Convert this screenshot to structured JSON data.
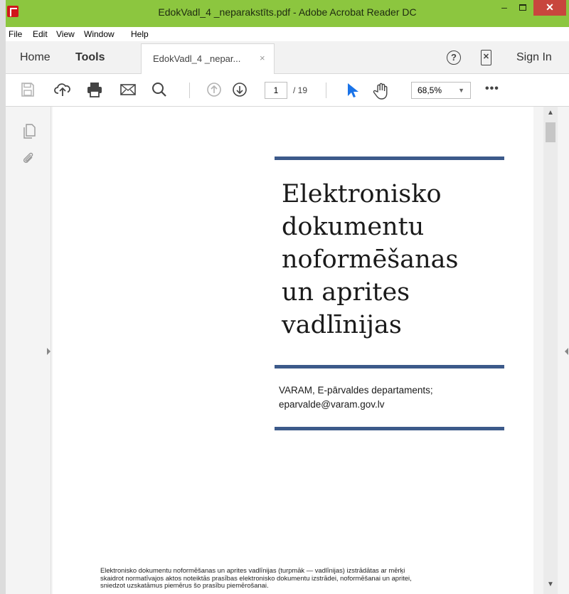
{
  "window": {
    "title": "EdokVadl_4 _neparakstīts.pdf - Adobe Acrobat Reader DC",
    "min_glyph": "–",
    "close_glyph": "✕"
  },
  "menu": {
    "items": [
      "File",
      "Edit",
      "View",
      "Window",
      "Help"
    ]
  },
  "tabs": {
    "home": "Home",
    "tools": "Tools",
    "document": "EdokVadl_4 _nepar...",
    "close_glyph": "×"
  },
  "header_right": {
    "help_glyph": "?",
    "sign_in": "Sign In"
  },
  "toolbar": {
    "page_current": "1",
    "page_total": "/ 19",
    "zoom": "68,5%",
    "zoom_chevron": "▼",
    "more": "•••"
  },
  "pdf": {
    "title_lines": [
      "Elektronisko",
      "dokumentu",
      "noformēšanas",
      "un aprites",
      "vadlīnijas"
    ],
    "author_lines": [
      "VARAM, E-pārvaldes departaments;",
      "eparvalde@varam.gov.lv"
    ],
    "intro_lines": [
      "Elektronisko dokumentu noformēšanas un aprites vadlīnijas (turpmāk — vadlīnijas) izstrādātas ar mērķi",
      "skaidrot normatīvajos aktos noteiktās prasības elektronisko dokumentu izstrādei, noformēšanai un apritei,",
      "sniedzot uzskatāmus piemērus šo prasību piemērošanai."
    ]
  },
  "scrollbar": {
    "up_glyph": "▲",
    "down_glyph": "▼"
  },
  "colors": {
    "titlebar": "#8cc63f",
    "close_button": "#c8463d",
    "rule": "#3c5a8a",
    "select_cursor": "#1a73e8"
  },
  "icons": [
    "save-icon",
    "upload-icon",
    "print-icon",
    "email-icon",
    "search-icon",
    "previous-page-icon",
    "next-page-icon",
    "select-cursor-icon",
    "hand-tool-icon",
    "pages-panel-icon",
    "attachments-icon"
  ]
}
